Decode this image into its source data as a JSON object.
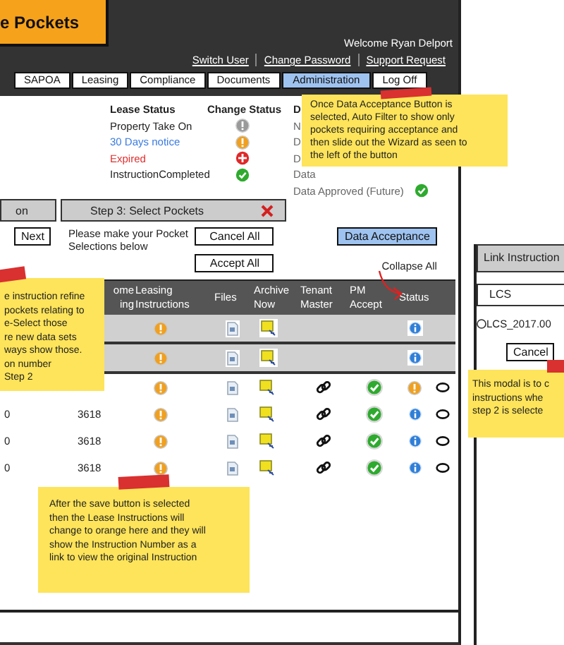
{
  "header": {
    "logo": "e Pockets",
    "welcome": "Welcome Ryan Delport",
    "links": [
      "Switch User",
      "Change Password",
      "Support Request"
    ],
    "tabs": [
      {
        "label": "SAPOA",
        "selected": false
      },
      {
        "label": "Leasing",
        "selected": false
      },
      {
        "label": "Compliance",
        "selected": false
      },
      {
        "label": "Documents",
        "selected": false
      },
      {
        "label": "Administration",
        "selected": true
      },
      {
        "label": "Log Off",
        "selected": false
      }
    ]
  },
  "legend": {
    "headings": [
      "Lease Status",
      "Change Status",
      "D"
    ],
    "statuses": [
      {
        "label": "Property Take On",
        "kind": "neutral",
        "color": "#222222"
      },
      {
        "label": "30 Days notice",
        "kind": "warning",
        "color": "#3a7be0"
      },
      {
        "label": "Expired",
        "kind": "error",
        "color": "#e03030"
      },
      {
        "label": "InstructionCompleted",
        "kind": "success",
        "color": "#222222"
      }
    ],
    "data_statuses": [
      {
        "label": "N",
        "approved": false
      },
      {
        "label": "D",
        "approved": false
      },
      {
        "label": "D",
        "approved": false
      },
      {
        "label": "Data",
        "approved": false
      },
      {
        "label": "Data Approved (Future)",
        "approved": true
      }
    ]
  },
  "wizard": {
    "steps": [
      {
        "label": "on",
        "closable": false
      },
      {
        "label": "Step 3: Select Pockets",
        "closable": true
      }
    ],
    "next": "Next",
    "instructions": "Please make your Pocket Selections below",
    "cancel_all": "Cancel All",
    "accept_all": "Accept All",
    "data_acceptance": "Data Acceptance",
    "collapse_all": "Collapse All"
  },
  "table": {
    "columns": [
      {
        "lines": [
          "ome",
          "ing"
        ]
      },
      {
        "lines": [
          "Leasing",
          "Instructions"
        ]
      },
      {
        "lines": [
          "Files"
        ]
      },
      {
        "lines": [
          "Archive",
          "Now"
        ]
      },
      {
        "lines": [
          "Tenant",
          "Master"
        ]
      },
      {
        "lines": [
          "PM",
          "Accept"
        ]
      },
      {
        "lines": [
          "Status"
        ]
      }
    ],
    "rows": [
      {
        "kind": "group",
        "leasing": {
          "kind": "warning"
        },
        "status": {
          "kind": "info"
        }
      },
      {
        "kind": "group",
        "leasing": {
          "kind": "warning"
        },
        "status": {
          "kind": "info"
        }
      },
      {
        "kind": "item",
        "leasing": {
          "kind": "warning"
        },
        "pm_accept": true,
        "status": {
          "kind": "warning"
        },
        "selected": false
      },
      {
        "kind": "item",
        "column_1": "0",
        "column_2": "3618",
        "leasing": {
          "kind": "warning"
        },
        "pm_accept": true,
        "status": {
          "kind": "info"
        },
        "selected": false
      },
      {
        "kind": "item",
        "column_1": "0",
        "column_2": "3618",
        "leasing": {
          "kind": "warning"
        },
        "pm_accept": true,
        "status": {
          "kind": "info"
        },
        "selected": false
      },
      {
        "kind": "item",
        "column_1": "0",
        "column_2": "3618",
        "leasing": {
          "kind": "warning"
        },
        "pm_accept": true,
        "status": {
          "kind": "info"
        },
        "selected": false
      }
    ]
  },
  "modal": {
    "title": "Link Instruction",
    "filter": "LCS",
    "options": [
      {
        "label": "LCS_2017.00",
        "selected": false
      }
    ],
    "cancel": "Cancel"
  },
  "notes": [
    {
      "lines": [
        "Once Data Acceptance Button is",
        "selected, Auto Filter to show only",
        "pockets requiring acceptance and",
        "then slide out the Wizard as seen to",
        "the left of the button"
      ]
    },
    {
      "lines": [
        "e instruction refine",
        "pockets relating to",
        "e-Select those",
        "re new data sets",
        "ways show those.",
        "on number",
        "Step 2"
      ]
    },
    {
      "lines": [
        "After the save button is selected",
        "then the Lease Instructions will",
        "change to orange here and they will",
        "show the Instruction Number as a",
        "link to view the original Instruction"
      ]
    },
    {
      "lines": [
        "This modal is to c",
        "instructions whe",
        "step 2 is selecte"
      ]
    }
  ]
}
